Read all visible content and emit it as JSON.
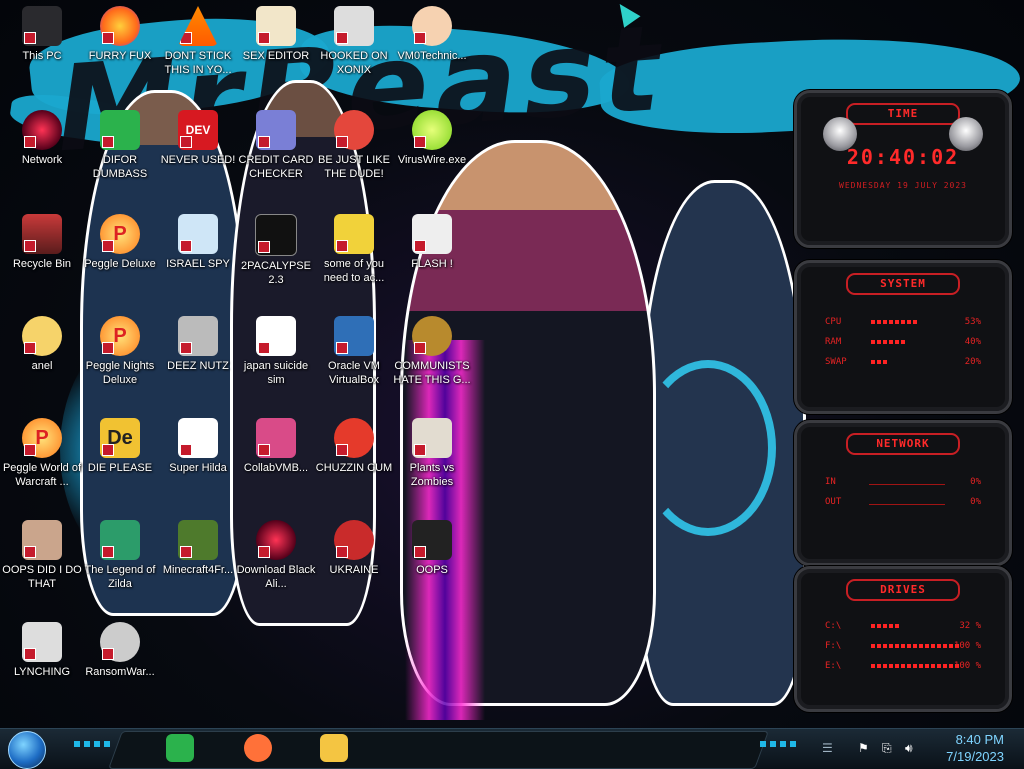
{
  "wallpaper": {
    "text": "MrBeast"
  },
  "icons": [
    {
      "label": "This PC",
      "kind": "pc"
    },
    {
      "label": "FURRY FUX",
      "kind": "firefox"
    },
    {
      "label": "DONT STICK THIS IN YO...",
      "kind": "vlc"
    },
    {
      "label": "SEX EDITOR",
      "kind": "xd"
    },
    {
      "label": "HOOKED ON XONIX",
      "kind": "xonix"
    },
    {
      "label": "VM0Technic...",
      "kind": "person"
    },
    {
      "label": "Network",
      "kind": "alien"
    },
    {
      "label": "DIFOR DUMBASS",
      "kind": "green"
    },
    {
      "label": "NEVER USED!",
      "kind": "dev"
    },
    {
      "label": "CREDIT CARD CHECKER",
      "kind": "card"
    },
    {
      "label": "BE JUST LIKE THE DUDE!",
      "kind": "santa"
    },
    {
      "label": "VirusWire.exe",
      "kind": "lime"
    },
    {
      "label": "Recycle Bin",
      "kind": "bin"
    },
    {
      "label": "Peggle Deluxe",
      "kind": "peggle"
    },
    {
      "label": "ISRAEL SPY",
      "kind": "spy"
    },
    {
      "label": "2PACALYPSE 2.3",
      "kind": "cmd"
    },
    {
      "label": "some of you need to ac...",
      "kind": "beaver"
    },
    {
      "label": "FLASH !",
      "kind": "flash"
    },
    {
      "label": "anel",
      "kind": "star"
    },
    {
      "label": "Peggle Nights Deluxe",
      "kind": "peggle"
    },
    {
      "label": "DEEZ NUTZ",
      "kind": "stack"
    },
    {
      "label": "japan suicide sim",
      "kind": "doc"
    },
    {
      "label": "Oracle VM VirtualBox",
      "kind": "vbox"
    },
    {
      "label": "COMMUNISTS HATE THIS G...",
      "kind": "money"
    },
    {
      "label": "Peggle World of Warcraft ...",
      "kind": "peggle"
    },
    {
      "label": "DIE PLEASE",
      "kind": "de"
    },
    {
      "label": "Super Hilda",
      "kind": "hilda"
    },
    {
      "label": "CollabVMB...",
      "kind": "collab"
    },
    {
      "label": "CHUZZIN CUM",
      "kind": "chuzzle"
    },
    {
      "label": "Plants vs Zombies",
      "kind": "pvz"
    },
    {
      "label": "OOPS DID I DO THAT",
      "kind": "portrait"
    },
    {
      "label": "The Legend of Zilda",
      "kind": "zelda"
    },
    {
      "label": "Minecraft4Fr...",
      "kind": "minecraft"
    },
    {
      "label": "Download Black Ali...",
      "kind": "alien"
    },
    {
      "label": "UKRAINE",
      "kind": "radiation"
    },
    {
      "label": "OOPS",
      "kind": "oops"
    },
    {
      "label": "LYNCHING",
      "kind": "lynch"
    },
    {
      "label": "RansomWar...",
      "kind": "skull"
    }
  ],
  "widgets": {
    "time": {
      "title": "TIME",
      "time": "20:40:02",
      "date": "WEDNESDAY 19 JULY 2023"
    },
    "system": {
      "title": "SYSTEM",
      "rows": [
        {
          "label": "CPU",
          "value": "53%",
          "percent": 53
        },
        {
          "label": "RAM",
          "value": "40%",
          "percent": 40
        },
        {
          "label": "SWAP",
          "value": "20%",
          "percent": 20
        }
      ]
    },
    "network": {
      "title": "NETWORK",
      "rows": [
        {
          "label": "IN",
          "value": "0%"
        },
        {
          "label": "OUT",
          "value": "0%"
        }
      ]
    },
    "drives": {
      "title": "DRIVES",
      "rows": [
        {
          "label": "C:\\",
          "value": "32 %",
          "percent": 32
        },
        {
          "label": "F:\\",
          "value": "100 %",
          "percent": 100
        },
        {
          "label": "E:\\",
          "value": "100 %",
          "percent": 100
        }
      ]
    }
  },
  "taskbar": {
    "apps": [
      {
        "name": "feedly",
        "color": "#2bb24c"
      },
      {
        "name": "firefox",
        "color": "#ff7139"
      },
      {
        "name": "file-explorer",
        "color": "#f4c542"
      }
    ],
    "time": "8:40 PM",
    "date": "7/19/2023"
  }
}
